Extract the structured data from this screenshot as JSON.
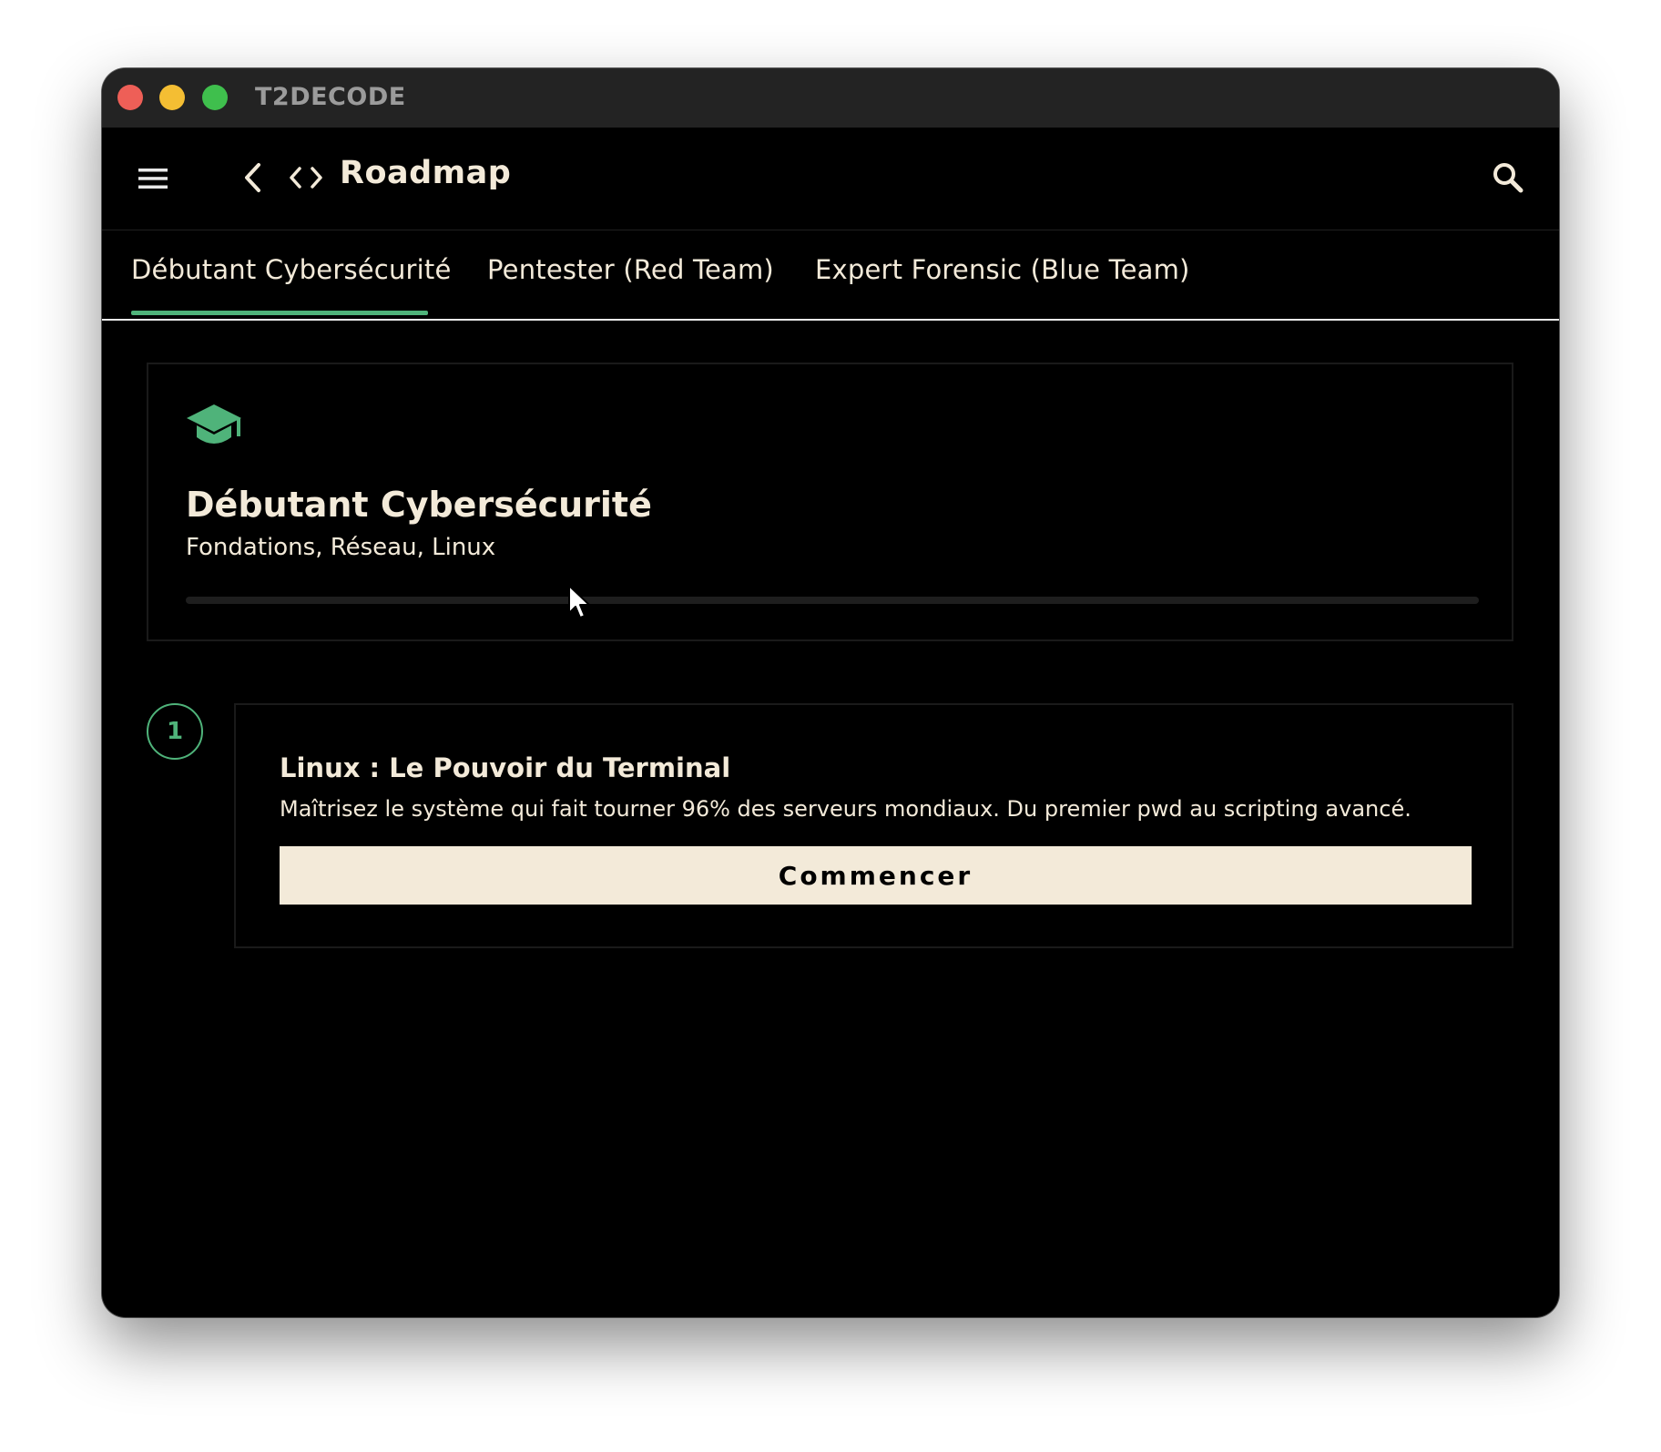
{
  "window": {
    "title": "T2DECODE"
  },
  "appbar": {
    "title": "Roadmap",
    "menu_icon": "hamburger-menu-icon",
    "back_icon": "chevron-left-icon",
    "code_icon": "code-brackets-icon",
    "search_icon": "search-icon"
  },
  "tabs": [
    {
      "label": "Débutant Cybersécurité",
      "selected": true
    },
    {
      "label": "Pentester (Red Team)",
      "selected": false
    },
    {
      "label": "Expert Forensic (Blue Team)",
      "selected": false
    }
  ],
  "track": {
    "icon": "graduation-cap-icon",
    "title": "Débutant Cybersécurité",
    "subtitle": "Fondations, Réseau, Linux",
    "progress": 0
  },
  "modules": [
    {
      "step": "1",
      "title": "Linux : Le Pouvoir du Terminal",
      "description": "Maîtrisez le système qui fait tourner 96% des serveurs mondiaux. Du premier pwd au scripting avancé.",
      "button_label": "Commencer"
    }
  ],
  "colors": {
    "accent": "#4fb37a",
    "text": "#f3ead9",
    "background": "#000000",
    "titlebar": "#232323",
    "button_bg": "#f3ead9"
  }
}
